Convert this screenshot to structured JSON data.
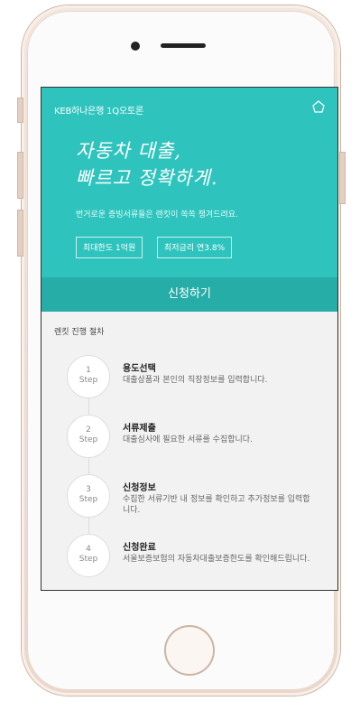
{
  "app": {
    "title": "KEB하나은행 1Q오토론",
    "headline_line1": "자동차 대출,",
    "headline_line2": "빠르고 정확하게.",
    "subcopy": "번거로운 증빙서류들은 렌킷이 쏙쏙 챙겨드려요.",
    "tags": [
      "최대한도 1억원",
      "최저금리 연3.8%"
    ],
    "apply_label": "신청하기"
  },
  "process": {
    "title": "렌킷 진행 절차",
    "steps": [
      {
        "num": "1",
        "label": "Step",
        "title": "용도선택",
        "desc": "대출상품과 본인의 직장정보를 입력합니다."
      },
      {
        "num": "2",
        "label": "Step",
        "title": "서류제출",
        "desc": "대출심사에 필요한 서류를 수집합니다."
      },
      {
        "num": "3",
        "label": "Step",
        "title": "신청정보",
        "desc": "수집한 서류기반 내 정보를 확인하고 추가정보를 입력합니다."
      },
      {
        "num": "4",
        "label": "Step",
        "title": "신청완료",
        "desc": "서울보증보험의 자동차대출보증한도를 확인해드립니다."
      }
    ]
  },
  "colors": {
    "accent": "#2ec4bd",
    "accent_dark": "#27ada7"
  },
  "icons": {
    "home": "home-icon"
  }
}
